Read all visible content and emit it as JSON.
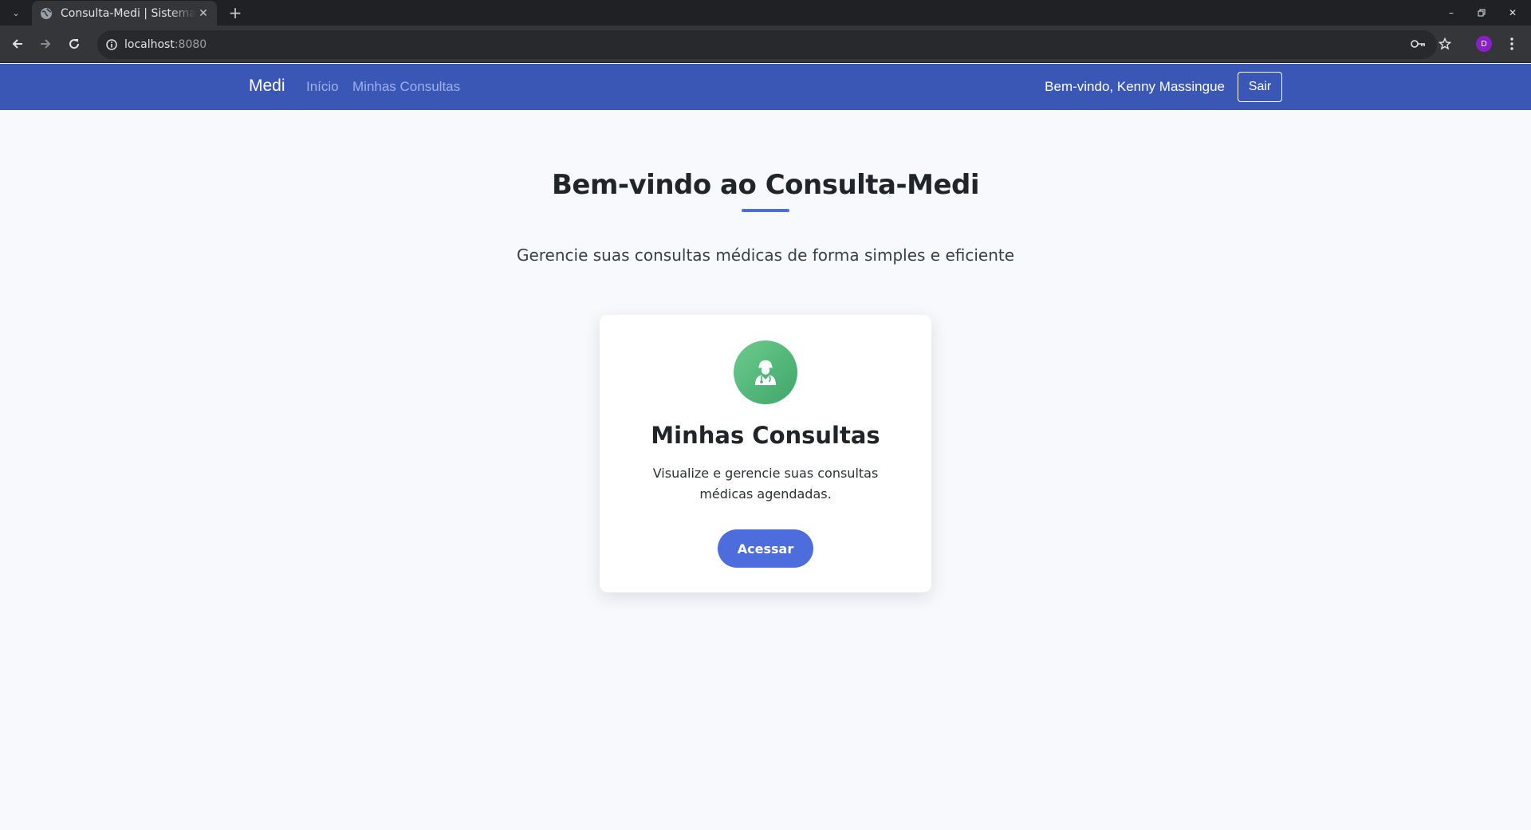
{
  "browser": {
    "tab_title": "Consulta-Medi | Sistema de Consultas",
    "url_host": "localhost",
    "url_port": ":8080",
    "avatar_letter": "D",
    "icons": [
      "tab-list-icon",
      "globe-icon",
      "close-icon",
      "plus-icon",
      "minimize-icon",
      "restore-icon",
      "back-arrow-icon",
      "forward-arrow-icon",
      "reload-icon",
      "info-icon",
      "key-icon",
      "star-icon",
      "kebab-menu-icon"
    ]
  },
  "navbar": {
    "brand": "Medi",
    "links": [
      "Início",
      "Minhas Consultas"
    ],
    "welcome": "Bem-vindo, Kenny Massingue",
    "logout": "Sair",
    "color": "#3b57b6"
  },
  "hero": {
    "title": "Bem-vindo ao Consulta-Medi",
    "subtitle": "Gerencie suas consultas médicas de forma simples e eficiente"
  },
  "card": {
    "icon": "doctor-icon",
    "title": "Minhas Consultas",
    "text": "Visualize e gerencie suas consultas médicas agendadas.",
    "button": "Acessar",
    "icon_color": "#4caf74",
    "button_color": "#4e6ddc"
  }
}
